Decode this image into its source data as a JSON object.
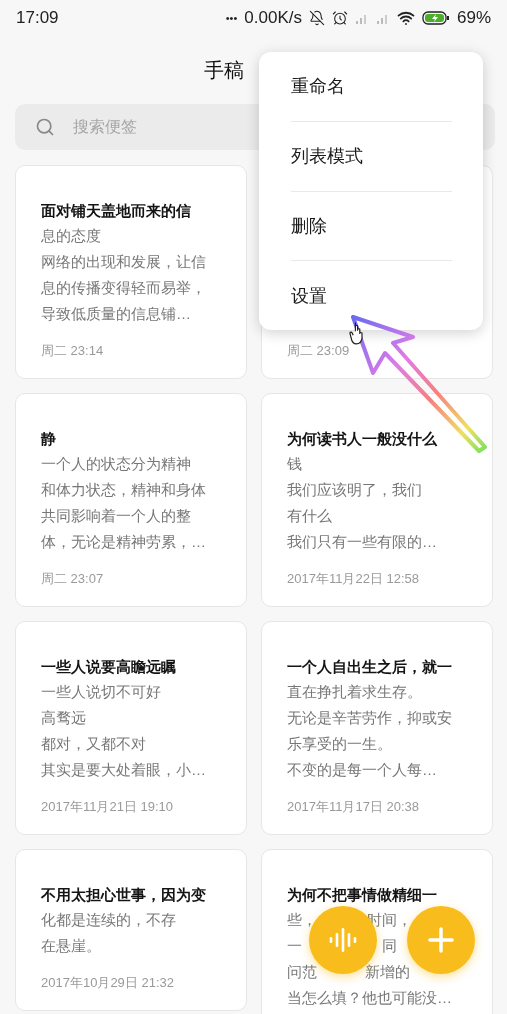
{
  "status_bar": {
    "time": "17:09",
    "dots": "•••",
    "net_speed": "0.00K/s",
    "battery": "69%"
  },
  "header": {
    "title": "手稿"
  },
  "search": {
    "placeholder": "搜索便签"
  },
  "menu": {
    "items": [
      "重命名",
      "列表模式",
      "删除",
      "设置"
    ]
  },
  "notes": [
    {
      "title": "面对铺天盖地而来的信",
      "lines": [
        "息的态度",
        "网络的出现和发展，让信",
        "息的传播变得轻而易举，",
        "导致低质量的信息铺…"
      ],
      "date": "周二 23:14"
    },
    {
      "date": "周二 23:09"
    },
    {
      "title": "静",
      "lines": [
        "一个人的状态分为精神",
        "和体力状态，精神和身体",
        "共同影响着一个人的整",
        "体，无论是精神劳累，…"
      ],
      "date": "周二 23:07"
    },
    {
      "title": "为何读书人一般没什么",
      "lines": [
        "钱",
        "我们应该明了，我们",
        "有什么",
        "我们只有一些有限的…"
      ],
      "date": "2017年11月22日 12:58"
    },
    {
      "title": "一些人说要高瞻远瞩",
      "lines": [
        "一些人说切不可好",
        "高骛远",
        "都对，又都不对",
        "其实是要大处着眼，小…"
      ],
      "date": "2017年11月21日 19:10"
    },
    {
      "title": "一个人自出生之后，就一",
      "lines": [
        "直在挣扎着求生存。",
        "无论是辛苦劳作，抑或安",
        "乐享受的一生。",
        "不变的是每一个人每…"
      ],
      "date": "2017年11月17日 20:38"
    },
    {
      "title": "不用太担心世事，因为变",
      "lines": [
        "化都是连续的，不存",
        "在悬崖。"
      ],
      "date": "2017年10月29日 21:32"
    },
    {
      "title": "为何不把事情做精细一",
      "lines": [
        [
          "些，",
          "时间，"
        ],
        [
          "一",
          "同"
        ],
        [
          "问范",
          "新增的"
        ],
        "当怎么填？他也可能没…"
      ]
    }
  ]
}
